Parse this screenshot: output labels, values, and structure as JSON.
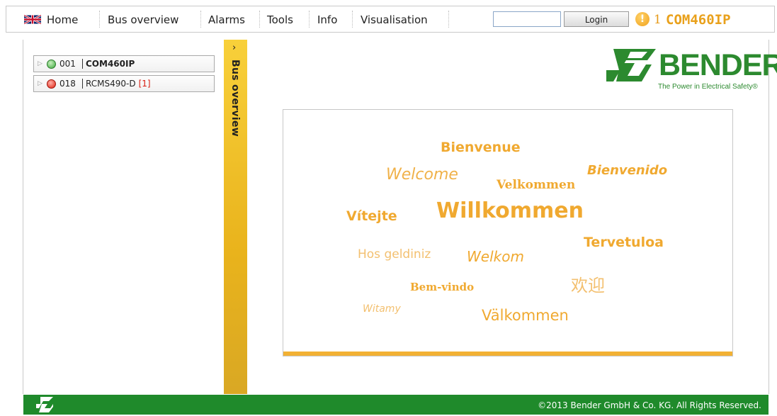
{
  "nav": {
    "home": "Home",
    "bus_overview": "Bus overview",
    "alarms": "Alarms",
    "tools": "Tools",
    "info": "Info",
    "visualisation": "Visualisation"
  },
  "login": {
    "input_value": "",
    "button_label": "Login"
  },
  "alarm": {
    "icon_glyph": "!",
    "count": "1"
  },
  "device_title": "COM460IP",
  "tree": {
    "items": [
      {
        "address": "001",
        "name": "COM460IP",
        "alarm": "",
        "status": "ok"
      },
      {
        "address": "018",
        "name": "RCMS490-D",
        "alarm": "[1]",
        "status": "alarm"
      }
    ]
  },
  "side_tab": {
    "arrow": "›",
    "label": "Bus overview"
  },
  "logo": {
    "name": "BENDER",
    "tagline": "The Power in Electrical Safety®"
  },
  "welcome_words": [
    "Bienvenue",
    "Welcome",
    "Bienvenido",
    "Velkommen",
    "Vítejte",
    "Willkommen",
    "Tervetuloa",
    "Hos geldiniz",
    "Welkom",
    "欢迎",
    "Bem-vindo",
    "Witamy",
    "Välkommen"
  ],
  "footer": {
    "copyright": "©2013 Bender GmbH & Co. KG. All Rights Reserved."
  },
  "colors": {
    "accent_orange": "#f0a930",
    "brand_green": "#2c8a2f",
    "footer_green": "#1f8a2b"
  }
}
